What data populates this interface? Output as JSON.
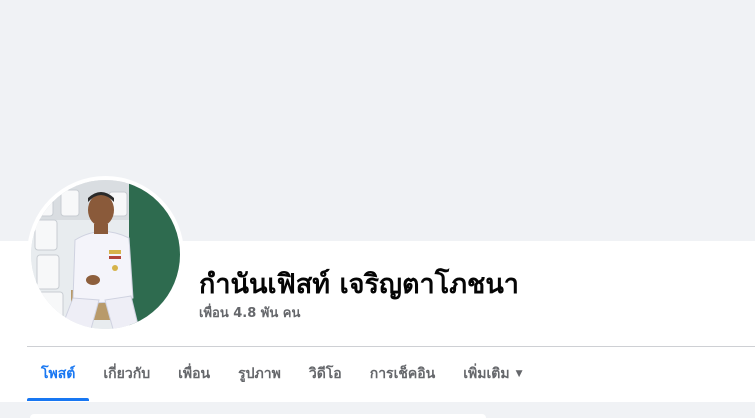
{
  "profile": {
    "name": "กำนันเฟิสท์ เจริญตาโภชนา",
    "friends_text": "เพื่อน 4.8 พัน คน",
    "avatar_alt": "profile-photo"
  },
  "tabs": [
    {
      "label": "โพสต์",
      "active": true
    },
    {
      "label": "เกี่ยวกับ",
      "active": false
    },
    {
      "label": "เพื่อน",
      "active": false
    },
    {
      "label": "รูปภาพ",
      "active": false
    },
    {
      "label": "วิดีโอ",
      "active": false
    },
    {
      "label": "การเช็คอิน",
      "active": false
    },
    {
      "label": "เพิ่มเติม",
      "active": false,
      "icon": "caret-down-icon"
    }
  ],
  "colors": {
    "accent": "#1877f2",
    "background": "#f0f2f5",
    "text_primary": "#050505",
    "text_secondary": "#65676b"
  }
}
